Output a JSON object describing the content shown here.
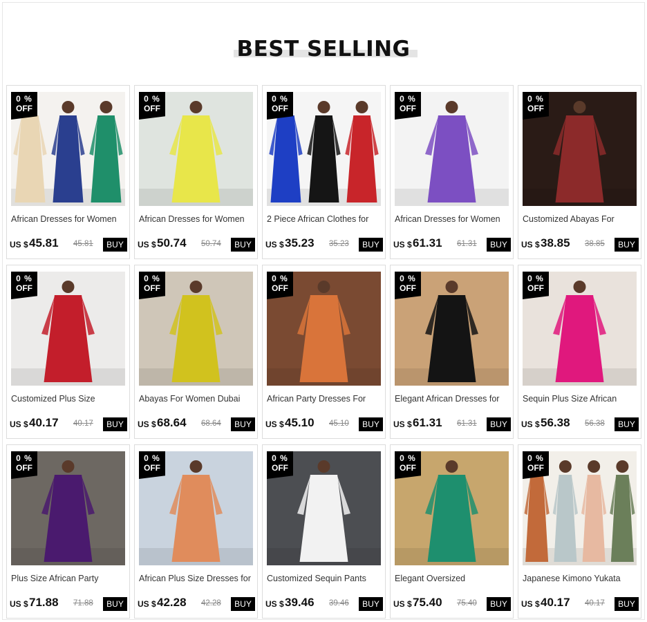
{
  "section": {
    "title": "BEST SELLING"
  },
  "badge": {
    "percent": "0 %",
    "off": "OFF"
  },
  "buy_label": "BUY",
  "currency": "US $",
  "products": [
    {
      "name": "African Dresses for Women",
      "price": "45.81",
      "old_price": "45.81",
      "bg": "#f4f2ef",
      "colors": [
        "#e9d6b4",
        "#2a3f8f",
        "#1f8f6a"
      ]
    },
    {
      "name": "African Dresses for Women",
      "price": "50.74",
      "old_price": "50.74",
      "bg": "#dfe4df",
      "colors": [
        "#e8e64a"
      ]
    },
    {
      "name": "2 Piece African Clothes for",
      "price": "35.23",
      "old_price": "35.23",
      "bg": "#f5f5f5",
      "colors": [
        "#1e3fc4",
        "#151515",
        "#c8252a"
      ]
    },
    {
      "name": "African Dresses for Women",
      "price": "61.31",
      "old_price": "61.31",
      "bg": "#f3f3f3",
      "colors": [
        "#7c4fc2"
      ]
    },
    {
      "name": "Customized Abayas For",
      "price": "38.85",
      "old_price": "38.85",
      "bg": "#2a1b16",
      "colors": [
        "#8c2a2a"
      ]
    },
    {
      "name": "Customized Plus Size",
      "price": "40.17",
      "old_price": "40.17",
      "bg": "#ecebea",
      "colors": [
        "#c31e2b"
      ]
    },
    {
      "name": "Abayas For Women Dubai",
      "price": "68.64",
      "old_price": "68.64",
      "bg": "#cfc6b8",
      "colors": [
        "#d1c21e"
      ]
    },
    {
      "name": "African Party Dresses For",
      "price": "45.10",
      "old_price": "45.10",
      "bg": "#7a4a32",
      "colors": [
        "#d9743a"
      ]
    },
    {
      "name": "Elegant African Dresses for",
      "price": "61.31",
      "old_price": "61.31",
      "bg": "#caa277",
      "colors": [
        "#141414"
      ]
    },
    {
      "name": "Sequin Plus Size African",
      "price": "56.38",
      "old_price": "56.38",
      "bg": "#e9e2dc",
      "colors": [
        "#e0187d"
      ]
    },
    {
      "name": "Plus Size African Party",
      "price": "71.88",
      "old_price": "71.88",
      "bg": "#6d6862",
      "colors": [
        "#4a1a6e"
      ]
    },
    {
      "name": "African Plus Size Dresses for",
      "price": "42.28",
      "old_price": "42.28",
      "bg": "#c9d3de",
      "colors": [
        "#e08c5c"
      ]
    },
    {
      "name": "Customized Sequin Pants",
      "price": "39.46",
      "old_price": "39.46",
      "bg": "#4c4e52",
      "colors": [
        "#f2f2f2"
      ]
    },
    {
      "name": "Elegant Oversized",
      "price": "75.40",
      "old_price": "75.40",
      "bg": "#c7a66d",
      "colors": [
        "#1e8f6e"
      ]
    },
    {
      "name": "Japanese Kimono Yukata",
      "price": "40.17",
      "old_price": "40.17",
      "bg": "#f2efe9",
      "colors": [
        "#c26a3a",
        "#b9c7c9",
        "#e7b9a1",
        "#6b7f5a"
      ]
    }
  ]
}
